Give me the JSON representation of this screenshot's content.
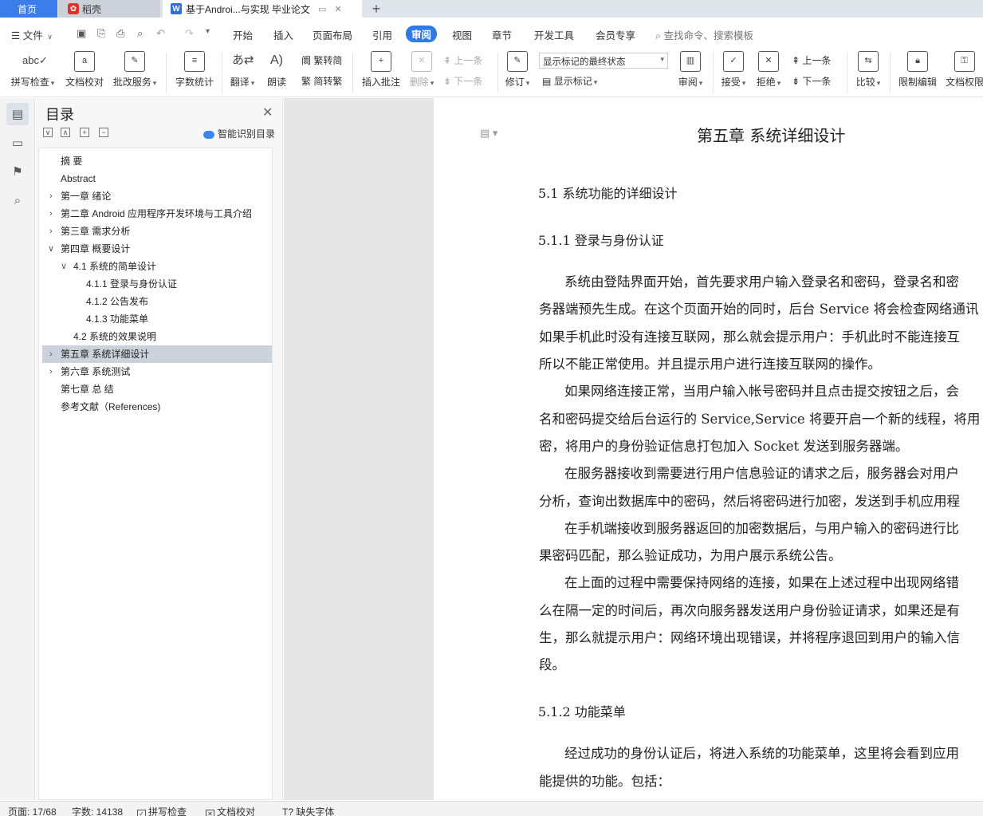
{
  "tabs": {
    "home": "首页",
    "docer": "稻壳",
    "document": "基于Androi...与实现 毕业论文"
  },
  "menu": {
    "file": "文件",
    "items": [
      "开始",
      "插入",
      "页面布局",
      "引用",
      "审阅",
      "视图",
      "章节",
      "开发工具",
      "会员专享"
    ],
    "active": "审阅",
    "search_placeholder": "查找命令、搜索模板"
  },
  "ribbon": {
    "spell_check": "拼写检查",
    "doc_proofread": "文档校对",
    "batch_service": "批改服务",
    "word_count": "字数统计",
    "translate": "翻译",
    "read_aloud": "朗读",
    "trad_to_simp": "繁转简",
    "simp_to_trad": "简转繁",
    "insert_comment": "插入批注",
    "delete": "删除",
    "prev_comment": "上一条",
    "next_comment": "下一条",
    "track_changes": "修订",
    "markup_mode": "显示标记的最终状态",
    "show_markup": "显示标记",
    "review": "审阅",
    "accept": "接受",
    "reject": "拒绝",
    "prev_change": "上一条",
    "next_change": "下一条",
    "compare": "比较",
    "restrict_edit": "限制编辑",
    "doc_permission": "文档权限"
  },
  "toc": {
    "title": "目录",
    "smart_toc": "智能识别目录",
    "items": [
      {
        "label": "摘    要"
      },
      {
        "label": "Abstract"
      },
      {
        "label": "第一章    绪论"
      },
      {
        "label": "第二章    Android 应用程序开发环境与工具介绍"
      },
      {
        "label": "第三章    需求分析"
      },
      {
        "label": "第四章    概要设计"
      },
      {
        "label": "4.1  系统的简单设计"
      },
      {
        "label": "4.1.1  登录与身份认证"
      },
      {
        "label": "4.1.2  公告发布"
      },
      {
        "label": "4.1.3  功能菜单"
      },
      {
        "label": "4.2 系统的效果说明"
      },
      {
        "label": "第五章    系统详细设计"
      },
      {
        "label": "第六章    系统测试"
      },
      {
        "label": "第七章  总  结"
      },
      {
        "label": "参考文献（References)"
      }
    ]
  },
  "document": {
    "chapter_title": "第五章      系统详细设计",
    "h_5_1": "5.1  系统功能的详细设计",
    "h_5_1_1": "5.1.1  登录与身份认证",
    "paragraphs": [
      "系统由登陆界面开始，首先要求用户输入登录名和密码，登录名和密",
      "务器端预先生成。在这个页面开始的同时，后台 Service 将会检查网络通讯",
      "如果手机此时没有连接互联网，那么就会提示用户：手机此时不能连接互",
      "所以不能正常使用。并且提示用户进行连接互联网的操作。",
      "如果网络连接正常，当用户输入帐号密码并且点击提交按钮之后，会",
      "名和密码提交给后台运行的 Service,Service 将要开启一个新的线程，将用",
      "密，将用户的身份验证信息打包加入 Socket 发送到服务器端。",
      "在服务器接收到需要进行用户信息验证的请求之后，服务器会对用户",
      "分析，查询出数据库中的密码，然后将密码进行加密，发送到手机应用程",
      "在手机端接收到服务器返回的加密数据后，与用户输入的密码进行比",
      "果密码匹配，那么验证成功，为用户展示系统公告。",
      "在上面的过程中需要保持网络的连接，如果在上述过程中出现网络错",
      "么在隔一定的时间后，再次向服务器发送用户身份验证请求，如果还是有",
      "生，那么就提示用户：网络环境出现错误，并将程序退回到用户的输入信",
      "段。"
    ],
    "h_5_1_2": "5.1.2  功能菜单",
    "paragraphs2": [
      "经过成功的身份认证后，将进入系统的功能菜单，这里将会看到应用",
      "能提供的功能。包括："
    ]
  },
  "status": {
    "page": "页面: 17/68",
    "words": "字数: 14138",
    "spell_check": "拼写检查",
    "doc_proofread": "文档校对",
    "missing_font": "缺失字体"
  }
}
